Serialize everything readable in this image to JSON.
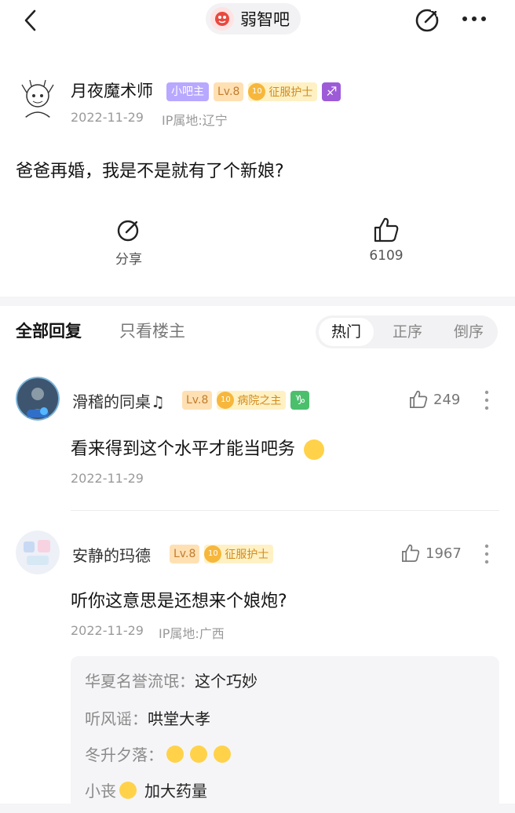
{
  "header": {
    "forum_name": "弱智吧"
  },
  "post": {
    "author": "月夜魔术师",
    "badges": {
      "owner": "小吧主",
      "level": "Lv.8",
      "title_num": "10",
      "title": "征服护士",
      "zodiac": "♐"
    },
    "date": "2022-11-29",
    "ip": "IP属地:辽宁",
    "content": "爸爸再婚，我是不是就有了个新娘?",
    "share_label": "分享",
    "like_count": "6109"
  },
  "reply_tabs": {
    "all": "全部回复",
    "op_only": "只看楼主"
  },
  "sort_options": [
    "热门",
    "正序",
    "倒序"
  ],
  "replies": [
    {
      "author": "滑稽的同桌♫",
      "level": "Lv.8",
      "title_num": "10",
      "title": "病院之主",
      "zodiac": "♑",
      "like_count": "249",
      "text": "看来得到这个水平才能当吧务",
      "date": "2022-11-29"
    },
    {
      "author": "安静的玛德",
      "level": "Lv.8",
      "title_num": "10",
      "title": "征服护士",
      "like_count": "1967",
      "text": "听你这意思是还想来个娘炮?",
      "date": "2022-11-29",
      "ip": "IP属地:广西",
      "sub_replies": [
        {
          "name": "华夏名誉流氓：",
          "text": "这个巧妙"
        },
        {
          "name": "听风谣：",
          "text": "哄堂大孝"
        },
        {
          "name": "冬升夕落：",
          "text": ""
        },
        {
          "name": "小丧",
          "text": "加大药量"
        }
      ]
    }
  ]
}
